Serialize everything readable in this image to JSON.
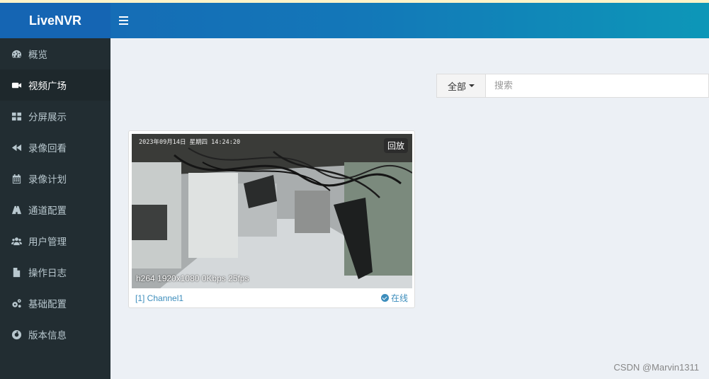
{
  "app": {
    "title": "LiveNVR"
  },
  "sidebar": {
    "items": [
      {
        "label": "概览",
        "icon": "dashboard-icon",
        "active": false
      },
      {
        "label": "视频广场",
        "icon": "video-camera-icon",
        "active": true
      },
      {
        "label": "分屏展示",
        "icon": "grid-icon",
        "active": false
      },
      {
        "label": "录像回看",
        "icon": "backward-icon",
        "active": false
      },
      {
        "label": "录像计划",
        "icon": "calendar-icon",
        "active": false
      },
      {
        "label": "通道配置",
        "icon": "road-icon",
        "active": false
      },
      {
        "label": "用户管理",
        "icon": "users-icon",
        "active": false
      },
      {
        "label": "操作日志",
        "icon": "file-icon",
        "active": false
      },
      {
        "label": "基础配置",
        "icon": "gears-icon",
        "active": false
      },
      {
        "label": "版本信息",
        "icon": "life-ring-icon",
        "active": false
      }
    ]
  },
  "search": {
    "filter_label": "全部",
    "placeholder": "搜索",
    "value": ""
  },
  "channels": [
    {
      "osd_time": "2023年09月14日 星期四 14:24:20",
      "replay_label": "回放",
      "stream_info": "h264 1920x1080 0Kbps 25fps",
      "name": "[1] Channel1",
      "status": "在线"
    }
  ],
  "watermark": "CSDN @Marvin1311",
  "colors": {
    "header": "#1668b5",
    "sidebar": "#222d32",
    "accent": "#3c8dbc",
    "background": "#ecf0f5"
  }
}
